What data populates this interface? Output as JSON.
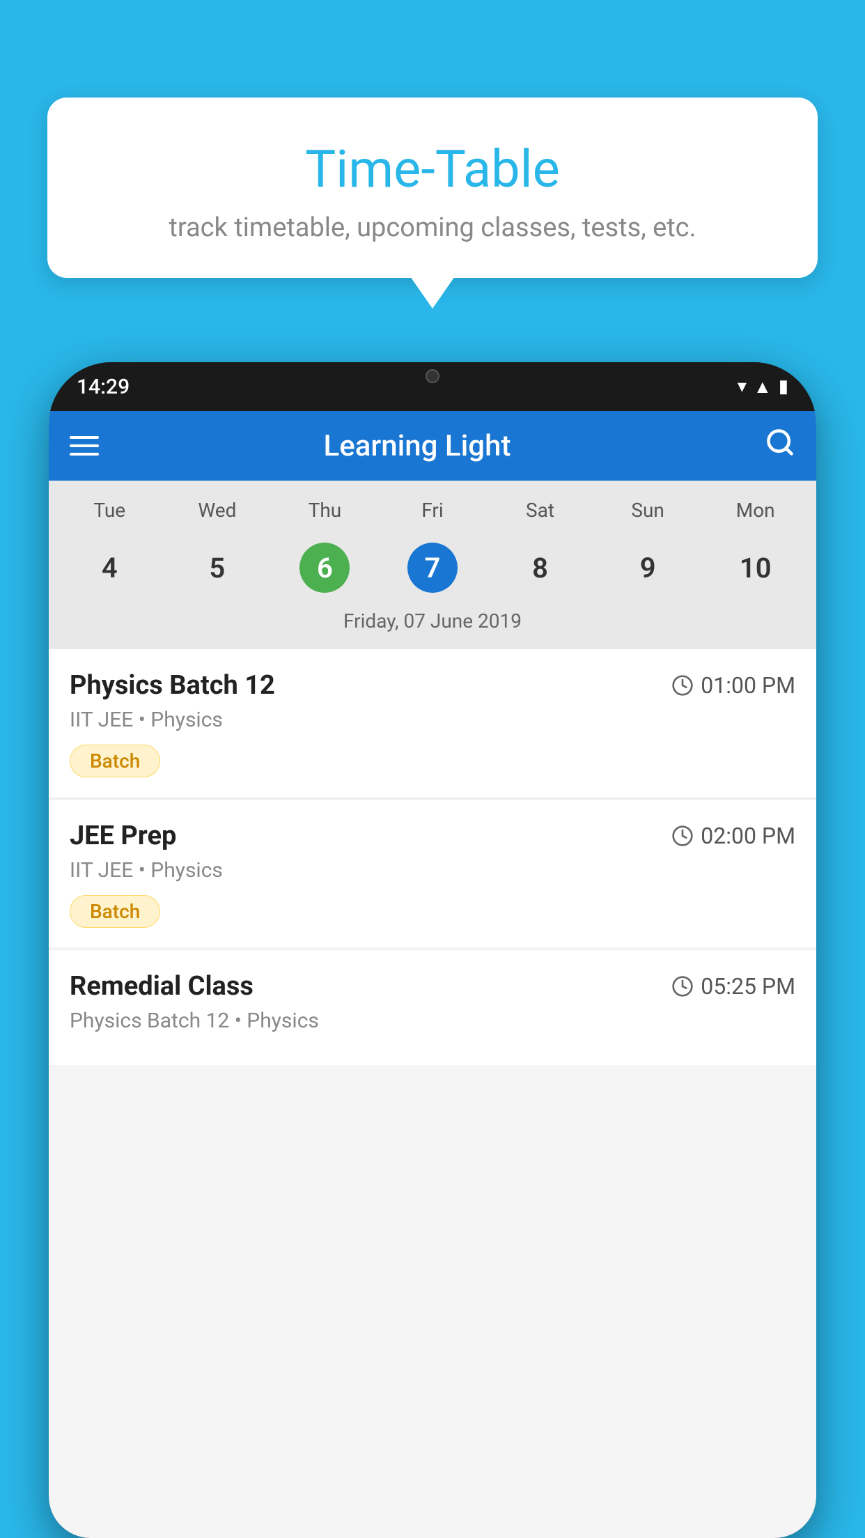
{
  "background_color": "#29B6E8",
  "tooltip": {
    "title": "Time-Table",
    "subtitle": "track timetable, upcoming classes, tests, etc."
  },
  "phone": {
    "time": "14:29",
    "app_title": "Learning Light",
    "calendar": {
      "days": [
        "Tue",
        "Wed",
        "Thu",
        "Fri",
        "Sat",
        "Sun",
        "Mon"
      ],
      "dates": [
        "4",
        "5",
        "6",
        "7",
        "8",
        "9",
        "10"
      ],
      "today_index": 2,
      "selected_index": 3,
      "selected_label": "Friday, 07 June 2019"
    },
    "schedule": [
      {
        "title": "Physics Batch 12",
        "time": "01:00 PM",
        "subtitle": "IIT JEE • Physics",
        "badge": "Batch"
      },
      {
        "title": "JEE Prep",
        "time": "02:00 PM",
        "subtitle": "IIT JEE • Physics",
        "badge": "Batch"
      },
      {
        "title": "Remedial Class",
        "time": "05:25 PM",
        "subtitle": "Physics Batch 12 • Physics",
        "badge": null
      }
    ]
  },
  "labels": {
    "menu_icon": "≡",
    "search_icon": "🔍",
    "clock_symbol": "🕐"
  }
}
